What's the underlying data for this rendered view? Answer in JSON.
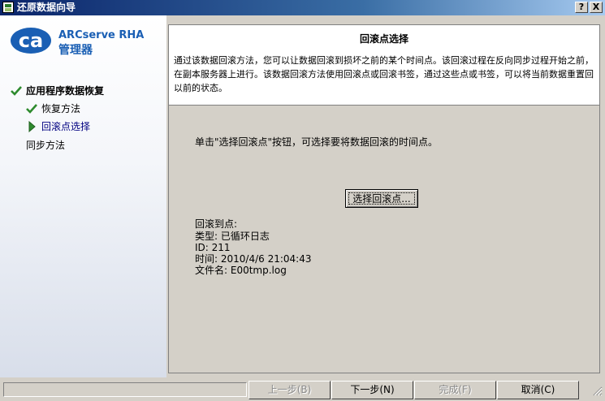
{
  "window": {
    "title": "还原数据向导",
    "help_label": "?",
    "close_label": "X"
  },
  "brand": {
    "logo_letters": "ca",
    "name": "ARCserve RHA",
    "subtitle": "管理器"
  },
  "nav": {
    "main": "应用程序数据恢复",
    "steps": [
      {
        "label": "恢复方法",
        "state": "done"
      },
      {
        "label": "回滚点选择",
        "state": "current"
      },
      {
        "label": "同步方法",
        "state": "pending"
      }
    ]
  },
  "header": {
    "title": "回滚点选择",
    "description": "通过该数据回滚方法，您可以让数据回滚到损坏之前的某个时间点。该回滚过程在反向同步过程开始之前，在副本服务器上进行。该数据回滚方法使用回滚点或回滚书签，通过这些点或书签，可以将当前数据重置回以前的状态。"
  },
  "main": {
    "instruction": "单击\"选择回滚点\"按钮，可选择要将数据回滚的时间点。",
    "select_button": "选择回滚点...",
    "info": {
      "heading": "回滚到点:",
      "type": "类型: 已循环日志",
      "id": "ID: 211",
      "time": "时间: 2010/4/6 21:04:43",
      "filename": "文件名: E00tmp.log"
    }
  },
  "buttons": {
    "back": "上一步(B)",
    "next": "下一步(N)",
    "finish": "完成(F)",
    "cancel": "取消(C)"
  },
  "colors": {
    "title_bar": "#0a246a",
    "check": "#2e8b2e",
    "current_arrow": "#2e8b2e",
    "brand": "#1a5fb4"
  }
}
